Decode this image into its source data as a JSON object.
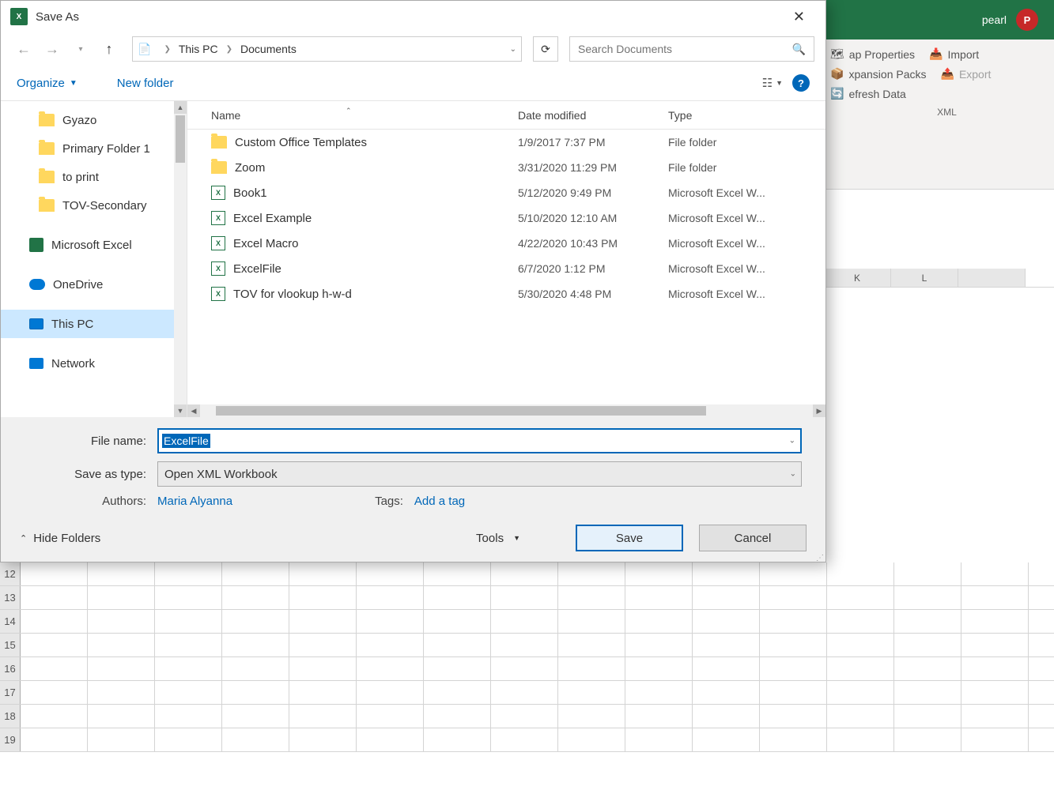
{
  "dialog": {
    "title": "Save As",
    "breadcrumb": {
      "root": "This PC",
      "current": "Documents"
    },
    "search_placeholder": "Search Documents",
    "organize_label": "Organize",
    "newfolder_label": "New folder",
    "columns": {
      "name": "Name",
      "date": "Date modified",
      "type": "Type"
    },
    "sidebar": [
      {
        "label": "Gyazo",
        "icon": "folder",
        "indent": 1
      },
      {
        "label": "Primary Folder 1",
        "icon": "folder",
        "indent": 1
      },
      {
        "label": "to print",
        "icon": "folder",
        "indent": 1
      },
      {
        "label": "TOV-Secondary",
        "icon": "folder",
        "indent": 1
      },
      {
        "label": "Microsoft Excel",
        "icon": "excel",
        "indent": 0
      },
      {
        "label": "OneDrive",
        "icon": "onedrive",
        "indent": 0
      },
      {
        "label": "This PC",
        "icon": "pc",
        "indent": 0,
        "selected": true
      },
      {
        "label": "Network",
        "icon": "network",
        "indent": 0
      }
    ],
    "files": [
      {
        "name": "Custom Office Templates",
        "date": "1/9/2017 7:37 PM",
        "type": "File folder",
        "icon": "folder"
      },
      {
        "name": "Zoom",
        "date": "3/31/2020 11:29 PM",
        "type": "File folder",
        "icon": "folder"
      },
      {
        "name": "Book1",
        "date": "5/12/2020 9:49 PM",
        "type": "Microsoft Excel W...",
        "icon": "excel"
      },
      {
        "name": "Excel Example",
        "date": "5/10/2020 12:10 AM",
        "type": "Microsoft Excel W...",
        "icon": "excel"
      },
      {
        "name": "Excel Macro",
        "date": "4/22/2020 10:43 PM",
        "type": "Microsoft Excel W...",
        "icon": "excel"
      },
      {
        "name": "ExcelFile",
        "date": "6/7/2020 1:12 PM",
        "type": "Microsoft Excel W...",
        "icon": "excel"
      },
      {
        "name": "TOV for vlookup h-w-d",
        "date": "5/30/2020 4:48 PM",
        "type": "Microsoft Excel W...",
        "icon": "excel"
      }
    ],
    "filename_label": "File name:",
    "filename_value": "ExcelFile",
    "savetype_label": "Save as type:",
    "savetype_value": "Open XML Workbook",
    "authors_label": "Authors:",
    "authors_value": "Maria Alyanna",
    "tags_label": "Tags:",
    "tags_value": "Add a tag",
    "hide_folders_label": "Hide Folders",
    "tools_label": "Tools",
    "save_label": "Save",
    "cancel_label": "Cancel"
  },
  "excel": {
    "user_name": "pearl",
    "user_initial": "P",
    "ribbon": {
      "map_props": "ap Properties",
      "import": "Import",
      "expansion": "xpansion Packs",
      "export": "Export",
      "refresh": "efresh Data",
      "group_label": "XML"
    },
    "cols": [
      "K",
      "L"
    ],
    "rows": [
      "12",
      "13",
      "14",
      "15",
      "16",
      "17",
      "18",
      "19"
    ]
  }
}
